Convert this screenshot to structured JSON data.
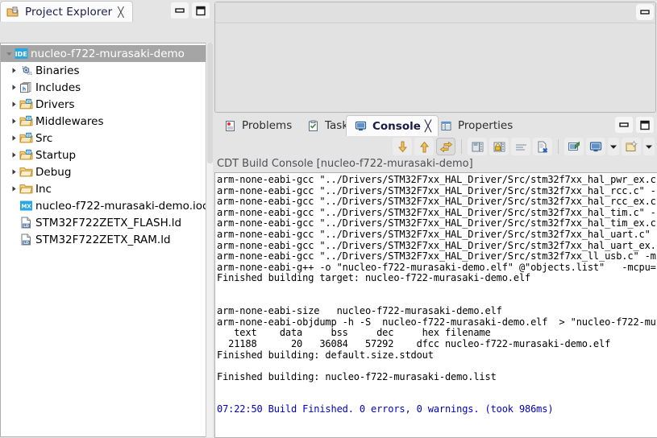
{
  "project_explorer": {
    "tab_label": "Project Explorer",
    "tab_icon": "project-explorer-icon",
    "close_label": "╳",
    "window_buttons": [
      {
        "name": "minimize-button",
        "label": "–"
      },
      {
        "name": "maximize-button",
        "label": "□"
      }
    ],
    "toolbar": [
      {
        "name": "collapse-all-button",
        "icon": "collapse-all-icon"
      },
      {
        "name": "link-with-editor-button",
        "icon": "link-with-editor-icon"
      },
      {
        "name": "view-menu-button",
        "icon": "chevron-down-icon"
      }
    ],
    "tree": [
      {
        "label": "nucleo-f722-murasaki-demo",
        "icon": "ide-project-icon",
        "arrow": "expanded",
        "selected": true,
        "indent": 0
      },
      {
        "label": "Binaries",
        "icon": "binaries-icon",
        "arrow": "collapsed",
        "selected": false,
        "indent": 1
      },
      {
        "label": "Includes",
        "icon": "includes-icon",
        "arrow": "collapsed",
        "selected": false,
        "indent": 1
      },
      {
        "label": "Drivers",
        "icon": "source-folder-icon",
        "arrow": "collapsed",
        "selected": false,
        "indent": 1
      },
      {
        "label": "Middlewares",
        "icon": "source-folder-icon",
        "arrow": "collapsed",
        "selected": false,
        "indent": 1
      },
      {
        "label": "Src",
        "icon": "source-folder-icon",
        "arrow": "collapsed",
        "selected": false,
        "indent": 1
      },
      {
        "label": "Startup",
        "icon": "source-folder-icon",
        "arrow": "collapsed",
        "selected": false,
        "indent": 1
      },
      {
        "label": "Debug",
        "icon": "folder-icon",
        "arrow": "collapsed",
        "selected": false,
        "indent": 1
      },
      {
        "label": "Inc",
        "icon": "folder-icon",
        "arrow": "collapsed",
        "selected": false,
        "indent": 1
      },
      {
        "label": "nucleo-f722-murasaki-demo.ioc",
        "icon": "ioc-file-icon",
        "arrow": "none",
        "selected": false,
        "indent": 1
      },
      {
        "label": "STM32F722ZETX_FLASH.ld",
        "icon": "linker-script-icon",
        "arrow": "none",
        "selected": false,
        "indent": 1
      },
      {
        "label": "STM32F722ZETX_RAM.ld",
        "icon": "linker-script-icon",
        "arrow": "none",
        "selected": false,
        "indent": 1
      }
    ]
  },
  "editor_area": {
    "minimize_button": "minimize-button"
  },
  "console_view": {
    "tabs": [
      {
        "label": "Problems",
        "icon": "problems-icon",
        "active": false,
        "closable": false
      },
      {
        "label": "Tasks",
        "icon": "tasks-icon",
        "active": false,
        "closable": false
      },
      {
        "label": "Console",
        "icon": "console-icon",
        "active": true,
        "closable": true
      },
      {
        "label": "Properties",
        "icon": "properties-icon",
        "active": false,
        "closable": false
      }
    ],
    "close_label": "╳",
    "window_buttons": [
      {
        "name": "minimize-button",
        "label": "–"
      },
      {
        "name": "maximize-button",
        "label": "□"
      }
    ],
    "toolbar": [
      {
        "name": "scroll-to-bottom-button",
        "icon": "arrow-down-icon"
      },
      {
        "name": "scroll-to-top-button",
        "icon": "arrow-up-icon"
      },
      {
        "name": "scroll-lock-button",
        "icon": "scroll-lock-icon",
        "pressed": true
      },
      {
        "name": "separator-1",
        "icon": "separator"
      },
      {
        "name": "save-console-button",
        "icon": "save-console-icon"
      },
      {
        "name": "pin-console-button",
        "icon": "pin-console-icon"
      },
      {
        "name": "word-wrap-button",
        "icon": "word-wrap-icon"
      },
      {
        "name": "clear-console-button",
        "icon": "clear-console-icon"
      },
      {
        "name": "separator-2",
        "icon": "separator"
      },
      {
        "name": "open-console-button",
        "icon": "open-console-icon"
      },
      {
        "name": "display-console-button",
        "icon": "display-console-icon"
      },
      {
        "name": "display-console-menu",
        "icon": "chevron-down-icon"
      },
      {
        "name": "new-console-button",
        "icon": "new-console-icon"
      },
      {
        "name": "new-console-menu",
        "icon": "chevron-down-icon"
      }
    ],
    "console_title": "CDT Build Console [nucleo-f722-murasaki-demo]",
    "lines": [
      {
        "text": "arm-none-eabi-gcc \"../Drivers/STM32F7xx_HAL_Driver/Src/stm32f7xx_hal_pwr_ex.c",
        "color": "black"
      },
      {
        "text": "arm-none-eabi-gcc \"../Drivers/STM32F7xx_HAL_Driver/Src/stm32f7xx_hal_rcc.c\" -",
        "color": "black"
      },
      {
        "text": "arm-none-eabi-gcc \"../Drivers/STM32F7xx_HAL_Driver/Src/stm32f7xx_hal_rcc_ex.c",
        "color": "black"
      },
      {
        "text": "arm-none-eabi-gcc \"../Drivers/STM32F7xx_HAL_Driver/Src/stm32f7xx_hal_tim.c\" -",
        "color": "black"
      },
      {
        "text": "arm-none-eabi-gcc \"../Drivers/STM32F7xx_HAL_Driver/Src/stm32f7xx_hal_tim_ex.c",
        "color": "black"
      },
      {
        "text": "arm-none-eabi-gcc \"../Drivers/STM32F7xx_HAL_Driver/Src/stm32f7xx_hal_uart.c\"",
        "color": "black"
      },
      {
        "text": "arm-none-eabi-gcc \"../Drivers/STM32F7xx_HAL_Driver/Src/stm32f7xx_hal_uart_ex.",
        "color": "black"
      },
      {
        "text": "arm-none-eabi-gcc \"../Drivers/STM32F7xx_HAL_Driver/Src/stm32f7xx_ll_usb.c\" -m",
        "color": "black"
      },
      {
        "text": "arm-none-eabi-g++ -o \"nucleo-f722-murasaki-demo.elf\" @\"objects.list\"   -mcpu=",
        "color": "black"
      },
      {
        "text": "Finished building target: nucleo-f722-murasaki-demo.elf",
        "color": "black"
      },
      {
        "text": "",
        "color": "black"
      },
      {
        "text": "",
        "color": "black"
      },
      {
        "text": "arm-none-eabi-size   nucleo-f722-murasaki-demo.elf",
        "color": "black"
      },
      {
        "text": "arm-none-eabi-objdump -h -S  nucleo-f722-murasaki-demo.elf  > \"nucleo-f722-mu",
        "color": "black"
      },
      {
        "text": "   text    data     bss     dec     hex filename",
        "color": "black"
      },
      {
        "text": "  21188      20   36084   57292    dfcc nucleo-f722-murasaki-demo.elf",
        "color": "black"
      },
      {
        "text": "Finished building: default.size.stdout",
        "color": "black"
      },
      {
        "text": "",
        "color": "black"
      },
      {
        "text": "Finished building: nucleo-f722-murasaki-demo.list",
        "color": "black"
      },
      {
        "text": "",
        "color": "black"
      },
      {
        "text": "",
        "color": "black"
      },
      {
        "text": "07:22:50 Build Finished. 0 errors, 0 warnings. (took 986ms)",
        "color": "blue"
      }
    ]
  },
  "colors": {
    "window_background": "#e4e4e4",
    "panel_background": "#ffffff",
    "tab_text": "#1b1b47",
    "selection_background": "#a5a5a5",
    "selection_text": "#ffffff",
    "console_title_text": "#4e4f53",
    "build_finished_text": "#0000c0",
    "folder_icon": "#e8a33d",
    "ioc_icon": "#29a8e0"
  }
}
